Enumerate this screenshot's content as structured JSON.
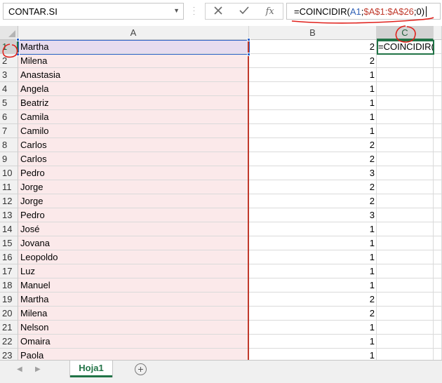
{
  "name_box": {
    "value": "CONTAR.SI"
  },
  "formula_bar": {
    "cancel_icon": "x-icon",
    "enter_icon": "check-icon",
    "function_label": "fx",
    "formula_parts": [
      "=COINCIDIR(",
      "A1",
      ";",
      "$A$1:$A$26",
      ";0)"
    ]
  },
  "columns": [
    "A",
    "B",
    "C"
  ],
  "active_cell": {
    "column": "C",
    "row": 1,
    "content": "=COINCIDIR("
  },
  "rows": [
    {
      "num": "1",
      "a": "Martha",
      "b": "2"
    },
    {
      "num": "2",
      "a": "Milena",
      "b": "2"
    },
    {
      "num": "3",
      "a": "Anastasia",
      "b": "1"
    },
    {
      "num": "4",
      "a": "Angela",
      "b": "1"
    },
    {
      "num": "5",
      "a": "Beatriz",
      "b": "1"
    },
    {
      "num": "6",
      "a": "Camila",
      "b": "1"
    },
    {
      "num": "7",
      "a": "Camilo",
      "b": "1"
    },
    {
      "num": "8",
      "a": "Carlos",
      "b": "2"
    },
    {
      "num": "9",
      "a": "Carlos",
      "b": "2"
    },
    {
      "num": "10",
      "a": "Pedro",
      "b": "3"
    },
    {
      "num": "11",
      "a": "Jorge",
      "b": "2"
    },
    {
      "num": "12",
      "a": "Jorge",
      "b": "2"
    },
    {
      "num": "13",
      "a": "Pedro",
      "b": "3"
    },
    {
      "num": "14",
      "a": "José",
      "b": "1"
    },
    {
      "num": "15",
      "a": "Jovana",
      "b": "1"
    },
    {
      "num": "16",
      "a": "Leopoldo",
      "b": "1"
    },
    {
      "num": "17",
      "a": "Luz",
      "b": "1"
    },
    {
      "num": "18",
      "a": "Manuel",
      "b": "1"
    },
    {
      "num": "19",
      "a": "Martha",
      "b": "2"
    },
    {
      "num": "20",
      "a": "Milena",
      "b": "2"
    },
    {
      "num": "21",
      "a": "Nelson",
      "b": "1"
    },
    {
      "num": "22",
      "a": "Omaira",
      "b": "1"
    },
    {
      "num": "23",
      "a": "Paola",
      "b": "1"
    }
  ],
  "sheet_tabs": [
    {
      "label": "Hoja1",
      "active": true
    }
  ],
  "colors": {
    "excel_green": "#217346",
    "range_blue": "#2e64c9",
    "annotation_red": "#e0201b",
    "names_fill": "#fbe9ea"
  }
}
